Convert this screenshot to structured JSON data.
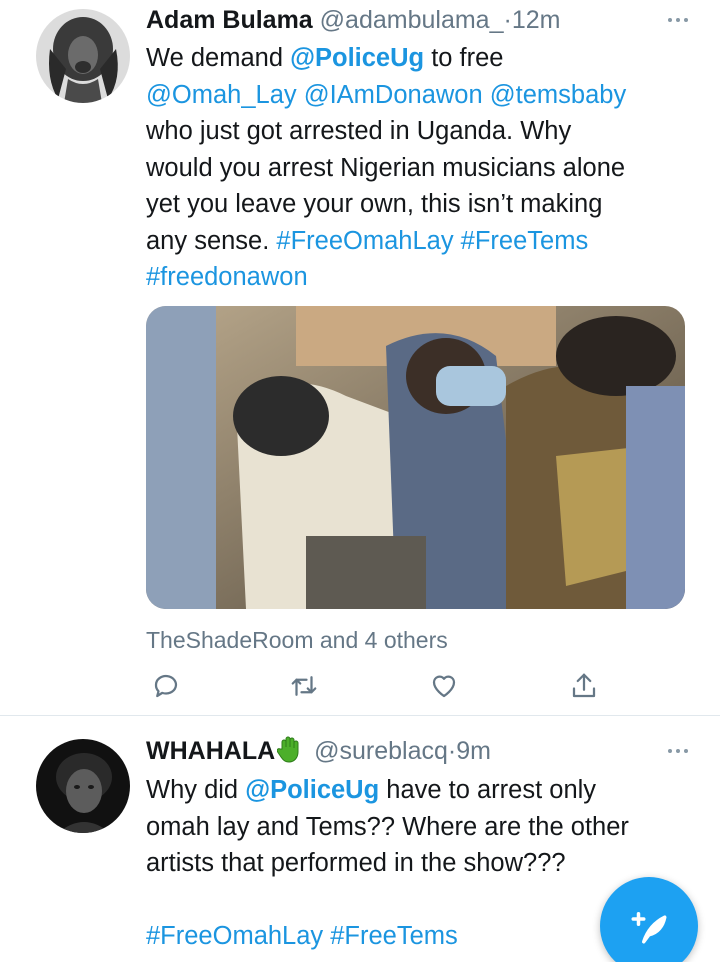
{
  "tweets": [
    {
      "name": "Adam Bulama",
      "handle": "@adambulama_",
      "separator": "·",
      "time": "12m",
      "text": {
        "l1_a": "We demand ",
        "l1_mention": "@PoliceUg",
        "l1_b": " to free",
        "l2": "@Omah_Lay @IAmDonawon @temsbaby",
        "l3": "who just got arrested in Uganda. Why",
        "l4": "would you arrest Nigerian musicians alone",
        "l5": "yet you leave your own, this isn’t making",
        "l6_a": "any sense. ",
        "l6_tags": "#FreeOmahLay #FreeTems",
        "l7": "#freedonawon"
      },
      "social_context": "TheShadeRoom and 4 others",
      "actions": [
        "reply-icon",
        "retweet-icon",
        "like-icon",
        "share-icon"
      ]
    },
    {
      "name": "WHAHALA",
      "emoji": "green-hand-emoji",
      "handle": "@sureblacq",
      "separator": "·",
      "time": "9m",
      "text": {
        "l1_a": "Why did ",
        "l1_mention": "@PoliceUg",
        "l1_b": " have to arrest only",
        "l2": "omah lay and Tems?? Where are the other",
        "l3": "artists that performed in the show???",
        "l5": "#FreeOmahLay #FreeTems"
      }
    }
  ],
  "fab": {
    "icon": "compose-tweet-icon"
  },
  "colors": {
    "link": "#1b95e0",
    "secondary": "#657786",
    "fab": "#1da1f2"
  }
}
